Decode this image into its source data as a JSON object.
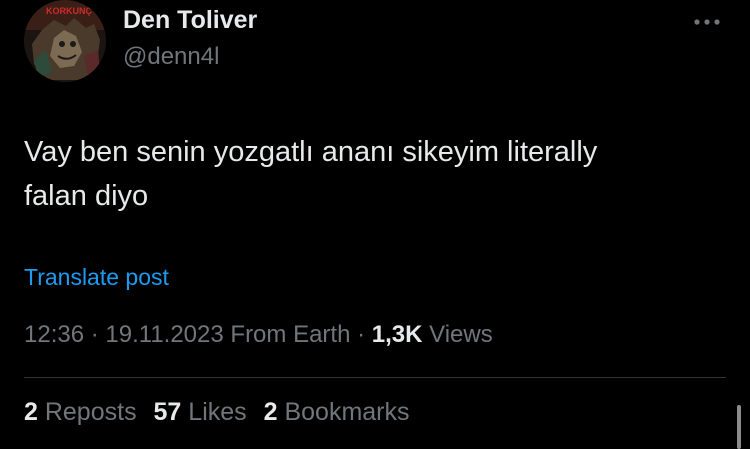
{
  "author": {
    "display_name": "Den Toliver",
    "handle": "@denn4l",
    "avatar_text": "KORKUNÇ"
  },
  "more_menu": {
    "icon": "more-horizontal-icon"
  },
  "tweet": {
    "text_line1": "Vay ben senin yozgatlı ananı sikeyim literally",
    "text_line2": "falan diyo",
    "translate_label": "Translate post"
  },
  "meta": {
    "time": "12:36",
    "sep1": " · ",
    "date": "19.11.2023",
    "source": " From Earth",
    "sep2": " · ",
    "views_count": "1,3K",
    "views_label": " Views"
  },
  "stats": {
    "reposts_count": "2",
    "reposts_label": " Reposts",
    "likes_count": "57",
    "likes_label": " Likes",
    "bookmarks_count": "2",
    "bookmarks_label": " Bookmarks"
  },
  "colors": {
    "background": "#000000",
    "text_primary": "#e7e9ea",
    "text_secondary": "#71767b",
    "link": "#1d9bf0",
    "divider": "#2f3336"
  }
}
